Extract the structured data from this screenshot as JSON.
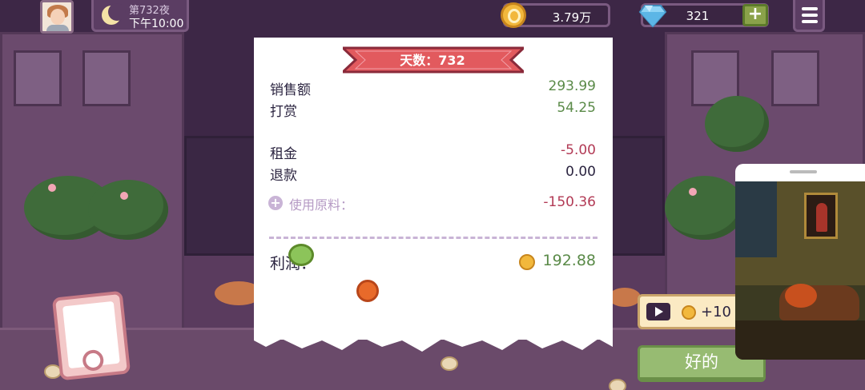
{
  "hud": {
    "night_label": "第732夜",
    "time_label": "下午10:00",
    "coins": "3.79万",
    "gems": "321",
    "gems_add": "+"
  },
  "receipt": {
    "day_banner": "天数：732",
    "rows": [
      {
        "label": "销售额",
        "value": "293.99"
      },
      {
        "label": "打赏",
        "value": "54.25"
      },
      {
        "label": "租金",
        "value": "-5.00"
      },
      {
        "label": "退款",
        "value": "0.00"
      }
    ],
    "ingredients": {
      "label": "使用原料：",
      "value": "-150.36"
    },
    "profit": {
      "label": "利润：",
      "value": "192.88"
    }
  },
  "ad_reward": {
    "value": "+10"
  },
  "ok_button": {
    "label": "好的"
  },
  "icons": {
    "avatar": "player-avatar",
    "moon": "moon-icon",
    "coin": "coin-icon",
    "gem": "diamond-icon",
    "menu": "hamburger-menu-icon",
    "play": "play-video-icon",
    "plus": "plus-icon"
  },
  "colors": {
    "positive": "#5a8a48",
    "negative": "#b23a55",
    "banner": "#e25a5e",
    "ok_button": "#97bb72"
  }
}
